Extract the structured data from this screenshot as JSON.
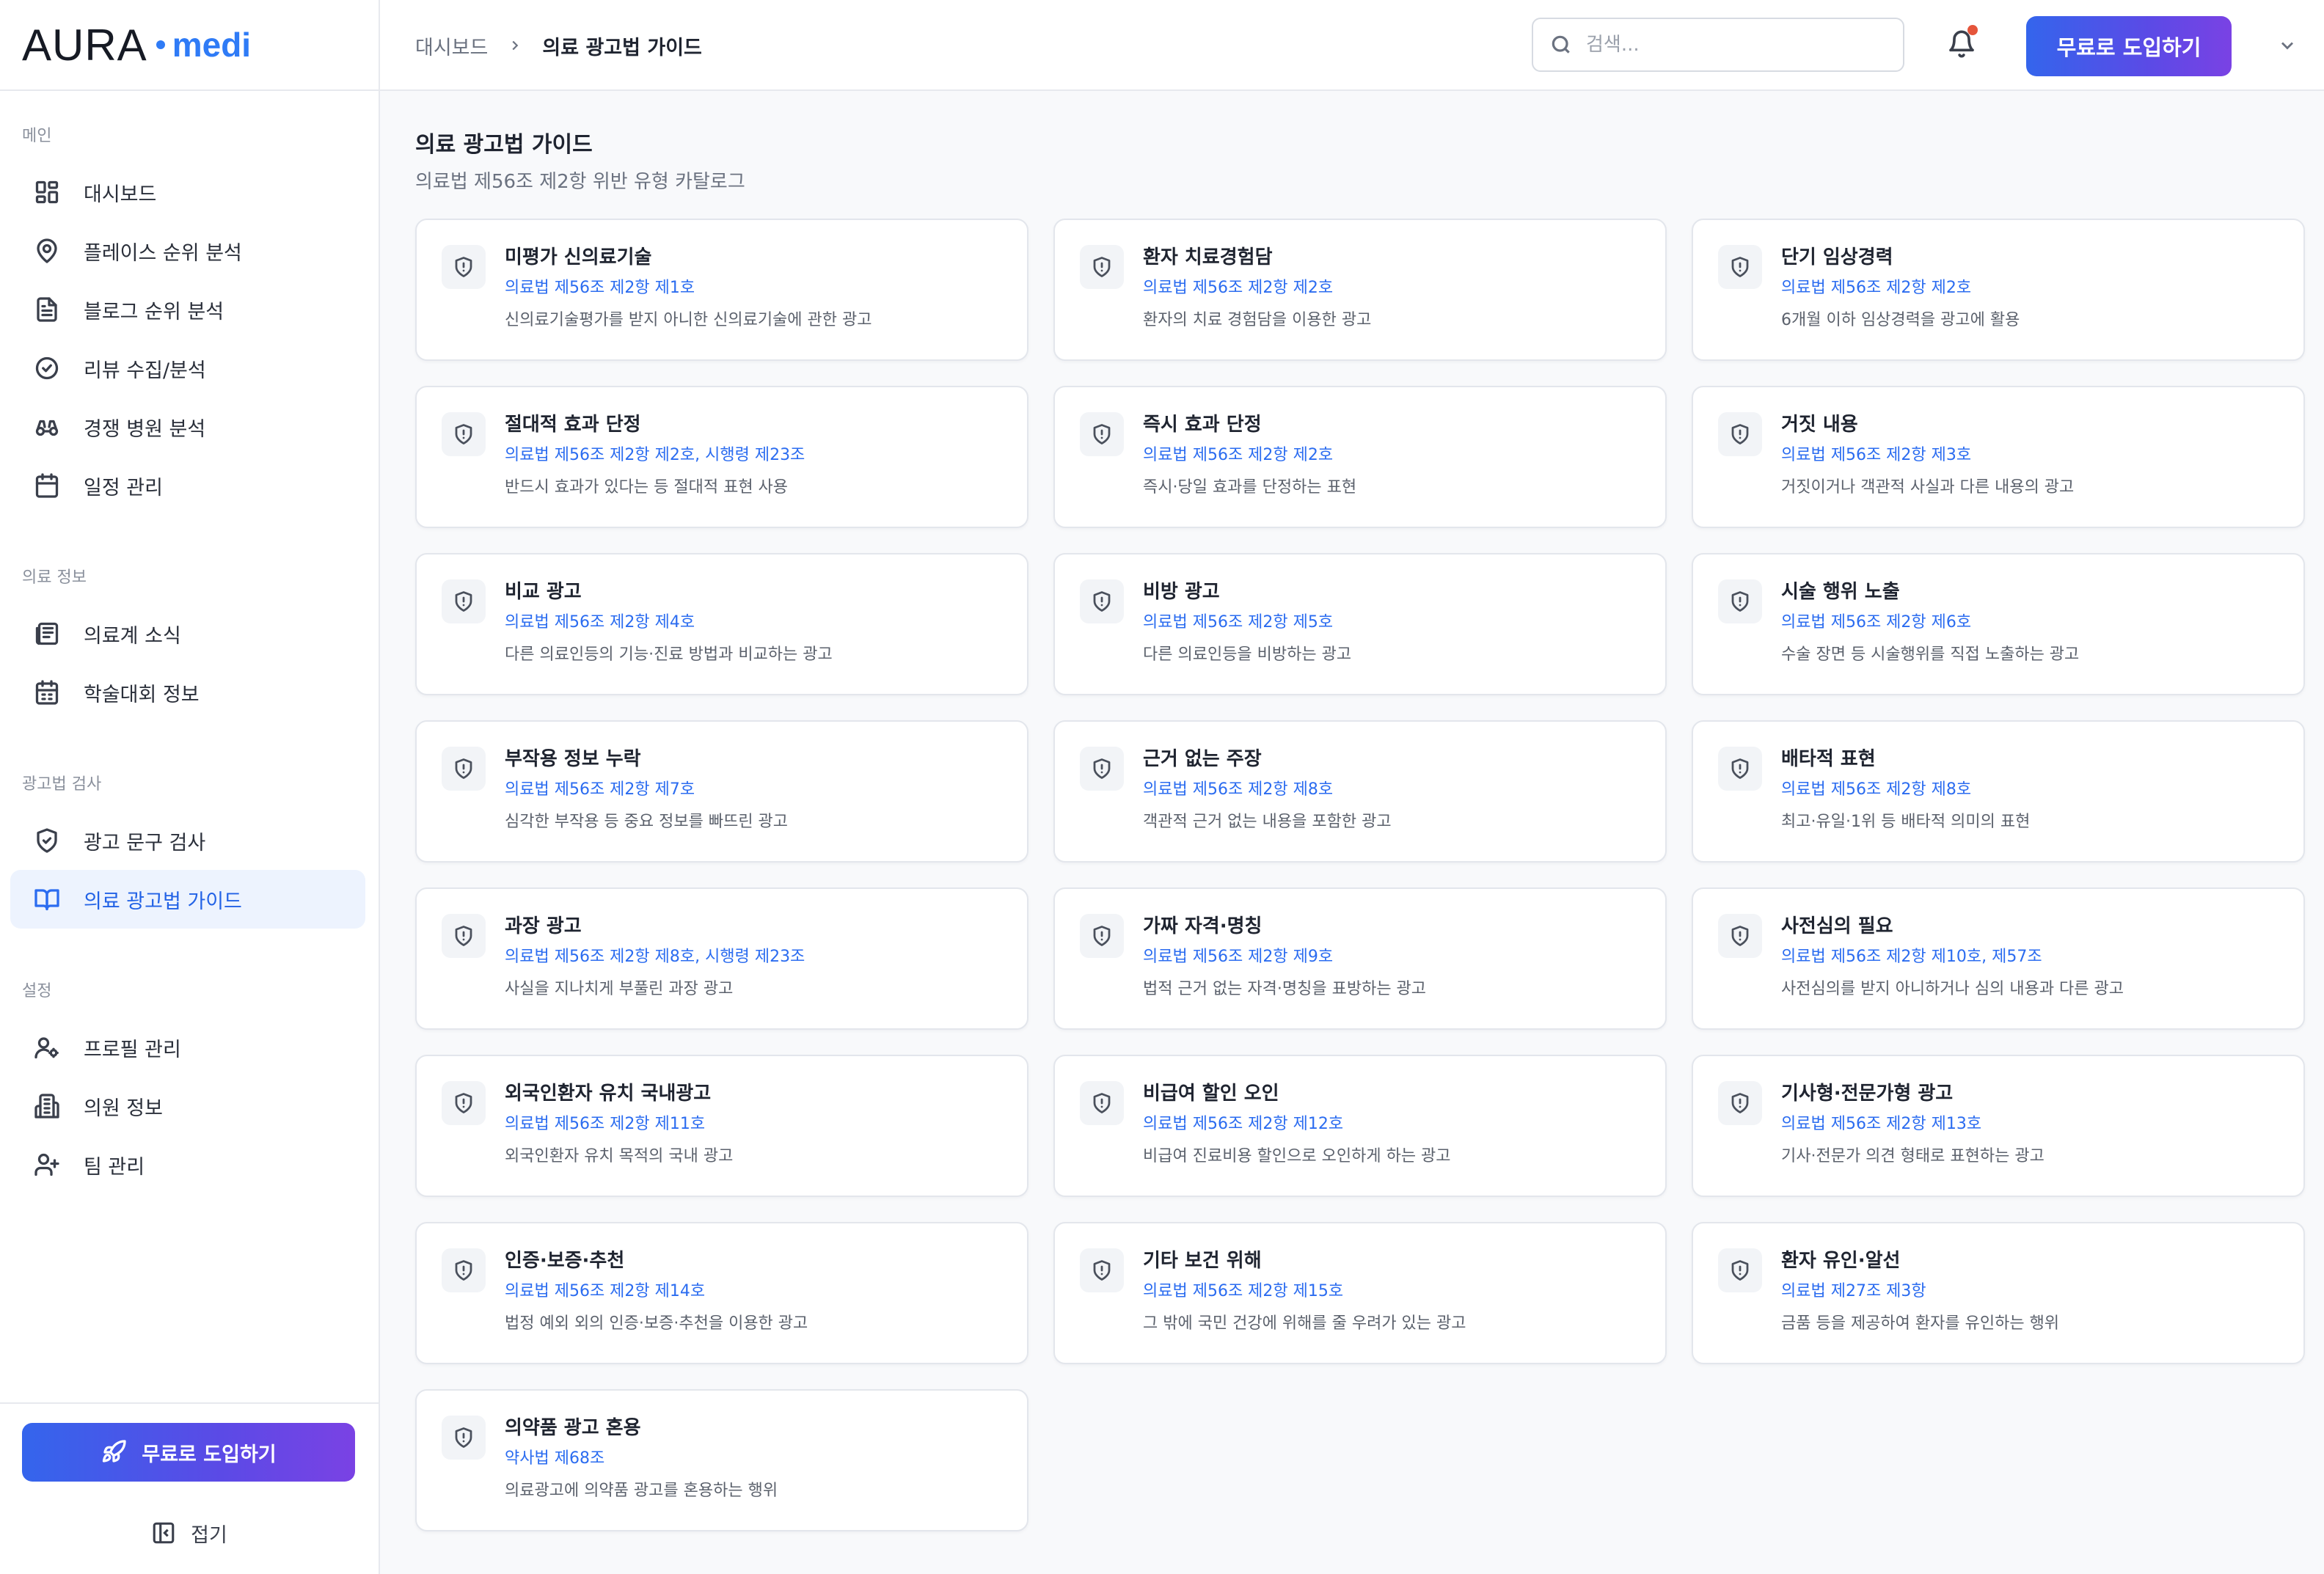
{
  "brand": {
    "name": "AURA",
    "suffix": "medi"
  },
  "sidebar": {
    "sections": [
      {
        "title": "메인",
        "items": [
          {
            "label": "대시보드",
            "icon": "dashboard-icon"
          },
          {
            "label": "플레이스 순위 분석",
            "icon": "map-pin-icon"
          },
          {
            "label": "블로그 순위 분석",
            "icon": "document-icon"
          },
          {
            "label": "리뷰 수집/분석",
            "icon": "check-circle-icon"
          },
          {
            "label": "경쟁 병원 분석",
            "icon": "binoculars-icon"
          },
          {
            "label": "일정 관리",
            "icon": "calendar-icon"
          }
        ]
      },
      {
        "title": "의료 정보",
        "items": [
          {
            "label": "의료계 소식",
            "icon": "newspaper-icon"
          },
          {
            "label": "학술대회 정보",
            "icon": "calendar-event-icon"
          }
        ]
      },
      {
        "title": "광고법 검사",
        "items": [
          {
            "label": "광고 문구 검사",
            "icon": "shield-check-icon"
          },
          {
            "label": "의료 광고법 가이드",
            "icon": "book-open-icon",
            "active": true
          }
        ]
      },
      {
        "title": "설정",
        "items": [
          {
            "label": "프로필 관리",
            "icon": "user-settings-icon"
          },
          {
            "label": "의원 정보",
            "icon": "building-icon"
          },
          {
            "label": "팀 관리",
            "icon": "user-plus-icon"
          }
        ]
      }
    ],
    "cta_label": "무료로 도입하기",
    "collapse_label": "접기"
  },
  "header": {
    "breadcrumb": [
      "대시보드",
      "의료 광고법 가이드"
    ],
    "search_placeholder": "검색...",
    "cta_label": "무료로 도입하기",
    "has_notification": true
  },
  "main": {
    "title": "의료 광고법 가이드",
    "subtitle": "의료법 제56조 제2항 위반 유형 카탈로그",
    "cards": [
      {
        "title": "미평가 신의료기술",
        "law": "의료법 제56조 제2항 제1호",
        "desc": "신의료기술평가를 받지 아니한 신의료기술에 관한 광고"
      },
      {
        "title": "환자 치료경험담",
        "law": "의료법 제56조 제2항 제2호",
        "desc": "환자의 치료 경험담을 이용한 광고"
      },
      {
        "title": "단기 임상경력",
        "law": "의료법 제56조 제2항 제2호",
        "desc": "6개월 이하 임상경력을 광고에 활용"
      },
      {
        "title": "절대적 효과 단정",
        "law": "의료법 제56조 제2항 제2호, 시행령 제23조",
        "desc": "반드시 효과가 있다는 등 절대적 표현 사용"
      },
      {
        "title": "즉시 효과 단정",
        "law": "의료법 제56조 제2항 제2호",
        "desc": "즉시·당일 효과를 단정하는 표현"
      },
      {
        "title": "거짓 내용",
        "law": "의료법 제56조 제2항 제3호",
        "desc": "거짓이거나 객관적 사실과 다른 내용의 광고"
      },
      {
        "title": "비교 광고",
        "law": "의료법 제56조 제2항 제4호",
        "desc": "다른 의료인등의 기능·진료 방법과 비교하는 광고"
      },
      {
        "title": "비방 광고",
        "law": "의료법 제56조 제2항 제5호",
        "desc": "다른 의료인등을 비방하는 광고"
      },
      {
        "title": "시술 행위 노출",
        "law": "의료법 제56조 제2항 제6호",
        "desc": "수술 장면 등 시술행위를 직접 노출하는 광고"
      },
      {
        "title": "부작용 정보 누락",
        "law": "의료법 제56조 제2항 제7호",
        "desc": "심각한 부작용 등 중요 정보를 빠뜨린 광고"
      },
      {
        "title": "근거 없는 주장",
        "law": "의료법 제56조 제2항 제8호",
        "desc": "객관적 근거 없는 내용을 포함한 광고"
      },
      {
        "title": "배타적 표현",
        "law": "의료법 제56조 제2항 제8호",
        "desc": "최고·유일·1위 등 배타적 의미의 표현"
      },
      {
        "title": "과장 광고",
        "law": "의료법 제56조 제2항 제8호, 시행령 제23조",
        "desc": "사실을 지나치게 부풀린 과장 광고"
      },
      {
        "title": "가짜 자격·명칭",
        "law": "의료법 제56조 제2항 제9호",
        "desc": "법적 근거 없는 자격·명칭을 표방하는 광고"
      },
      {
        "title": "사전심의 필요",
        "law": "의료법 제56조 제2항 제10호, 제57조",
        "desc": "사전심의를 받지 아니하거나 심의 내용과 다른 광고"
      },
      {
        "title": "외국인환자 유치 국내광고",
        "law": "의료법 제56조 제2항 제11호",
        "desc": "외국인환자 유치 목적의 국내 광고"
      },
      {
        "title": "비급여 할인 오인",
        "law": "의료법 제56조 제2항 제12호",
        "desc": "비급여 진료비용 할인으로 오인하게 하는 광고"
      },
      {
        "title": "기사형·전문가형 광고",
        "law": "의료법 제56조 제2항 제13호",
        "desc": "기사·전문가 의견 형태로 표현하는 광고"
      },
      {
        "title": "인증·보증·추천",
        "law": "의료법 제56조 제2항 제14호",
        "desc": "법정 예외 외의 인증·보증·추천을 이용한 광고"
      },
      {
        "title": "기타 보건 위해",
        "law": "의료법 제56조 제2항 제15호",
        "desc": "그 밖에 국민 건강에 위해를 줄 우려가 있는 광고"
      },
      {
        "title": "환자 유인·알선",
        "law": "의료법 제27조 제3항",
        "desc": "금품 등을 제공하여 환자를 유인하는 행위"
      },
      {
        "title": "의약품 광고 혼용",
        "law": "약사법 제68조",
        "desc": "의료광고에 의약품 광고를 혼용하는 행위"
      }
    ]
  },
  "colors": {
    "accent": "#2b6cf0",
    "cta_start": "#3465ec",
    "cta_end": "#7a42e4",
    "notification": "#e5553b"
  }
}
